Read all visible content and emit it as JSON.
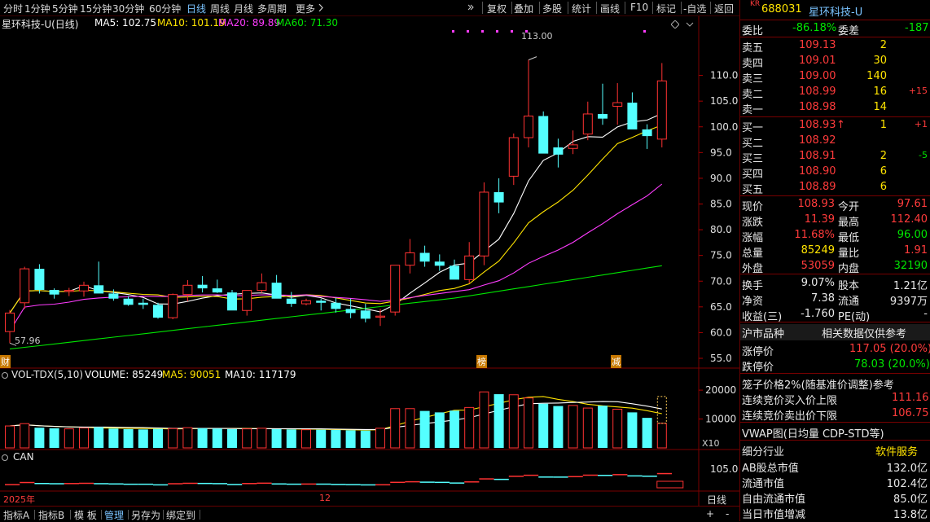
{
  "topbar": {
    "periods": [
      "分时",
      "1分钟",
      "5分钟",
      "15分钟",
      "30分钟",
      "60分钟",
      "日线",
      "周线",
      "月线",
      "多周期",
      "更多"
    ],
    "active_period": "日线",
    "tools": [
      "复权",
      "叠加",
      "多股",
      "统计",
      "画线",
      "F10",
      "标记",
      "-自选",
      "返回"
    ]
  },
  "chart": {
    "title": "星环科技-U(日线)",
    "ma": [
      {
        "label": "MA5: 102.75",
        "color": "#ffffff"
      },
      {
        "label": "MA10: 101.19",
        "color": "#ffe400"
      },
      {
        "label": "MA20: 89.89",
        "color": "#ff3cff"
      },
      {
        "label": "MA60: 71.30",
        "color": "#00e600"
      }
    ],
    "high_label": "113.00",
    "low_label": "57.96",
    "y_ticks": [
      "110.0",
      "105.0",
      "100.0",
      "95.0",
      "90.0",
      "85.0",
      "80.0",
      "75.0",
      "70.0",
      "65.0",
      "60.0",
      "55.0"
    ],
    "markers": [
      "财",
      "榜",
      "减"
    ],
    "vol_title": "VOL-TDX(5,10)",
    "vol_labels": [
      {
        "label": "VOLUME: 85249",
        "color": "#ffffff"
      },
      {
        "label": "MA5: 90051",
        "color": "#ffe400"
      },
      {
        "label": "MA10: 117179",
        "color": "#ffffff"
      }
    ],
    "vol_ticks": [
      "20000",
      "10000"
    ],
    "vol_unit": "X10",
    "can_title": "CAN",
    "can_tick": "105.0",
    "date_labels": [
      "2025年",
      "12"
    ],
    "period_label": "日线"
  },
  "chart_data": {
    "type": "candlestick",
    "ylim": [
      55,
      115
    ],
    "candles": [
      [
        60.2,
        64.4,
        57.96,
        63.8
      ],
      [
        65.8,
        72.8,
        64.6,
        72.4
      ],
      [
        72.4,
        73.3,
        67.6,
        68.3
      ],
      [
        68.3,
        68.6,
        66.6,
        67.4
      ],
      [
        68.0,
        68.7,
        67.1,
        68.2
      ],
      [
        68.1,
        69.9,
        67.0,
        69.2
      ],
      [
        69.2,
        73.8,
        68.3,
        67.6
      ],
      [
        67.6,
        68.4,
        66.2,
        66.6
      ],
      [
        66.6,
        67.1,
        65.2,
        65.4
      ],
      [
        65.8,
        66.6,
        64.6,
        65.4
      ],
      [
        65.4,
        65.8,
        62.7,
        62.9
      ],
      [
        62.9,
        67.6,
        62.6,
        67.4
      ],
      [
        67.4,
        70.2,
        66.1,
        69.2
      ],
      [
        69.3,
        71.0,
        67.8,
        68.6
      ],
      [
        68.6,
        70.3,
        67.7,
        67.8
      ],
      [
        67.8,
        68.3,
        64.8,
        64.3
      ],
      [
        64.3,
        68.2,
        63.3,
        68.2
      ],
      [
        68.2,
        71.5,
        67.7,
        69.7
      ],
      [
        69.7,
        71.2,
        67.1,
        66.6
      ],
      [
        66.6,
        67.9,
        65.0,
        65.6
      ],
      [
        65.6,
        66.6,
        65.3,
        66.2
      ],
      [
        66.2,
        66.6,
        64.3,
        65.8
      ],
      [
        65.8,
        66.8,
        63.9,
        64.6
      ],
      [
        64.6,
        66.6,
        62.8,
        63.8
      ],
      [
        64.3,
        65.6,
        62.0,
        62.7
      ],
      [
        63.0,
        64.6,
        61.3,
        63.2
      ],
      [
        64.0,
        67.4,
        63.3,
        73.1
      ],
      [
        73.1,
        78.2,
        71.5,
        75.5
      ],
      [
        75.5,
        76.9,
        72.8,
        73.8
      ],
      [
        73.8,
        75.2,
        72.0,
        73.0
      ],
      [
        73.0,
        74.2,
        70.8,
        70.3
      ],
      [
        70.3,
        77.6,
        69.6,
        74.9
      ],
      [
        74.9,
        89.2,
        73.1,
        87.3
      ],
      [
        87.3,
        90.0,
        83.2,
        85.3
      ],
      [
        90.4,
        98.7,
        88.7,
        97.9
      ],
      [
        97.9,
        113.0,
        96.0,
        102.1
      ],
      [
        102.1,
        103.0,
        96.6,
        94.8
      ],
      [
        96.0,
        97.7,
        92.1,
        94.6
      ],
      [
        95.8,
        99.3,
        94.7,
        96.5
      ],
      [
        98.6,
        104.9,
        97.4,
        102.5
      ],
      [
        102.5,
        108.4,
        100.4,
        101.6
      ],
      [
        104.0,
        108.5,
        100.4,
        104.7
      ],
      [
        104.7,
        106.7,
        101.4,
        99.5
      ],
      [
        99.5,
        100.5,
        95.7,
        98.2
      ],
      [
        97.61,
        112.4,
        96.0,
        108.93
      ]
    ],
    "volume": [
      7600,
      8400,
      7000,
      6800,
      6600,
      6900,
      7200,
      6700,
      6500,
      6400,
      6600,
      6700,
      7000,
      6800,
      6700,
      6500,
      6600,
      6800,
      6500,
      6400,
      6300,
      6300,
      6200,
      6100,
      6000,
      6800,
      13600,
      13600,
      12800,
      12300,
      12900,
      14000,
      19400,
      18600,
      18400,
      17300,
      15300,
      14500,
      14700,
      13800,
      14600,
      13400,
      12300,
      10400,
      8525
    ],
    "ma5_volume": 90051,
    "ma10_volume": 117179,
    "last": {
      "open": 97.61,
      "high": 112.4,
      "low": 96.0,
      "close": 108.93
    }
  },
  "right": {
    "market_tag": "KR",
    "code": "688031",
    "name": "星环科技-U",
    "wei_bi_label": "委比",
    "wei_bi": "-86.18%",
    "wei_cha_label": "委差",
    "wei_cha": "-187",
    "sells": [
      {
        "label": "卖五",
        "price": "109.13",
        "vol": "2",
        "chg": ""
      },
      {
        "label": "卖四",
        "price": "109.01",
        "vol": "30",
        "chg": ""
      },
      {
        "label": "卖三",
        "price": "109.00",
        "vol": "140",
        "chg": ""
      },
      {
        "label": "卖二",
        "price": "108.99",
        "vol": "16",
        "chg": "+15"
      },
      {
        "label": "卖一",
        "price": "108.98",
        "vol": "14",
        "chg": ""
      }
    ],
    "buys": [
      {
        "label": "买一",
        "price": "108.93",
        "arrow": "↑",
        "vol": "1",
        "chg": "+1"
      },
      {
        "label": "买二",
        "price": "108.92",
        "arrow": "",
        "vol": "",
        "chg": ""
      },
      {
        "label": "买三",
        "price": "108.91",
        "arrow": "",
        "vol": "2",
        "chg": "-5"
      },
      {
        "label": "买四",
        "price": "108.90",
        "arrow": "",
        "vol": "6",
        "chg": ""
      },
      {
        "label": "买五",
        "price": "108.89",
        "arrow": "",
        "vol": "6",
        "chg": ""
      }
    ],
    "quote": [
      {
        "l1": "现价",
        "v1": "108.93",
        "c1": "red",
        "l2": "今开",
        "v2": "97.61",
        "c2": "red"
      },
      {
        "l1": "涨跌",
        "v1": "11.39",
        "c1": "red",
        "l2": "最高",
        "v2": "112.40",
        "c2": "red"
      },
      {
        "l1": "涨幅",
        "v1": "11.68%",
        "c1": "red",
        "l2": "最低",
        "v2": "96.00",
        "c2": "grn"
      },
      {
        "l1": "总量",
        "v1": "85249",
        "c1": "yel",
        "l2": "量比",
        "v2": "1.91",
        "c2": "red"
      },
      {
        "l1": "外盘",
        "v1": "53059",
        "c1": "red",
        "l2": "内盘",
        "v2": "32190",
        "c2": "grn"
      }
    ],
    "fund": [
      {
        "l1": "换手",
        "v1": "9.07%",
        "l2": "股本",
        "v2": "1.21亿"
      },
      {
        "l1": "净资",
        "v1": "7.38",
        "l2": "流通",
        "v2": "9397万"
      },
      {
        "l1": "收益(三)",
        "v1": "-1.760",
        "l2": "PE(动)",
        "v2": "-"
      }
    ],
    "market_label": "沪市品种",
    "market_note": "相关数据仅供参考",
    "limit_up_label": "涨停价",
    "limit_up": "117.05 (20.0%)",
    "limit_down_label": "跌停价",
    "limit_down": "78.03 (20.0%)",
    "cage_text": "笼子价格2%(随基准价调整)参考",
    "auction_buy_label": "连续竞价买入价上限",
    "auction_buy": "111.16",
    "auction_sell_label": "连续竞价卖出价下限",
    "auction_sell": "106.75",
    "vwap_text": "VWAP图(日均量 CDP-STD等)",
    "industry_label": "细分行业",
    "industry": "软件服务",
    "mv": [
      {
        "l": "AB股总市值",
        "v": "132.0亿"
      },
      {
        "l": "流通市值",
        "v": "102.4亿"
      },
      {
        "l": "自由流通市值",
        "v": "85.0亿"
      },
      {
        "l": "当日市值增减",
        "v": "13.8亿"
      }
    ]
  },
  "bottombar": {
    "tabs": [
      "指标A",
      "指标B",
      "模 板",
      "管理",
      "另存为",
      "绑定到"
    ],
    "active": "管理",
    "plus": "+",
    "minus": "-"
  }
}
